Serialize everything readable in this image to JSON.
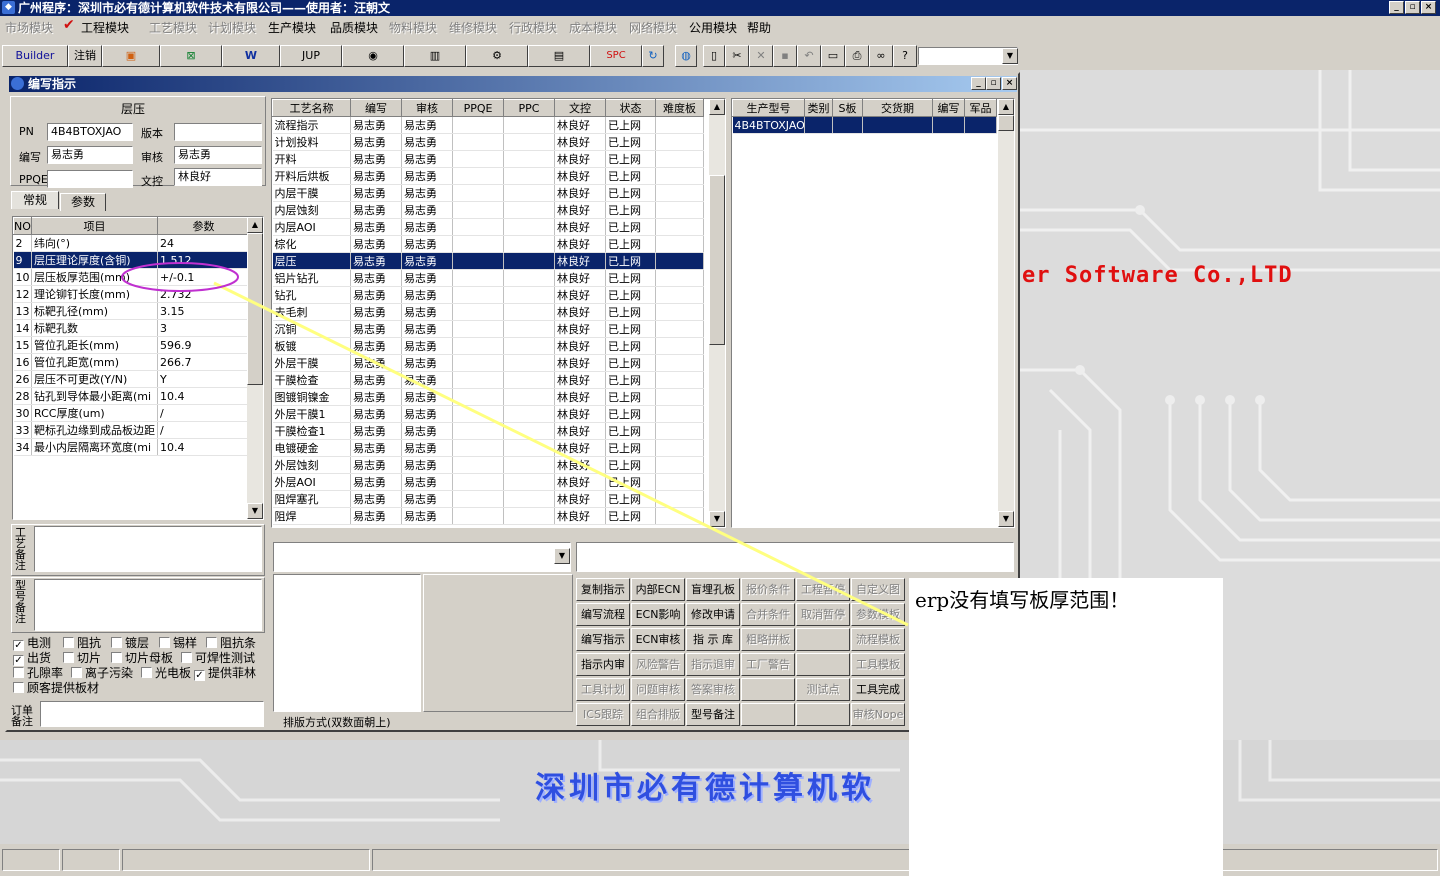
{
  "window": {
    "title": "广州程序：深圳市必有德计算机软件技术有限公司——使用者：汪朝文",
    "buttons": [
      "_",
      "▫",
      "×"
    ]
  },
  "menu": [
    {
      "label": "市场模块",
      "enabled": false
    },
    {
      "label": "工程模块",
      "enabled": true,
      "checked": true
    },
    {
      "label": "工艺模块",
      "enabled": false
    },
    {
      "label": "计划模块",
      "enabled": false
    },
    {
      "label": "生产模块",
      "enabled": true
    },
    {
      "label": "品质模块",
      "enabled": true
    },
    {
      "label": "物料模块",
      "enabled": false
    },
    {
      "label": "维修模块",
      "enabled": false
    },
    {
      "label": "行政模块",
      "enabled": false
    },
    {
      "label": "成本模块",
      "enabled": false
    },
    {
      "label": "网络模块",
      "enabled": false
    },
    {
      "label": "公用模块",
      "enabled": true
    },
    {
      "label": "帮助",
      "enabled": true
    }
  ],
  "toolbar": {
    "builder": "Builder",
    "logout": "注销",
    "jup": "JUP",
    "spc": "SPC",
    "combo_value": ""
  },
  "child": {
    "title": "编写指示",
    "section_title": "层压",
    "fields": {
      "pn_label": "PN",
      "pn_value": "4B4BTOXJAO",
      "version_label": "版本",
      "version_value": "",
      "author_label": "编写",
      "author_value": "易志勇",
      "review_label": "审核",
      "review_value": "易志勇",
      "ppqe_label": "PPQE",
      "ppqe_value": "",
      "doc_label": "文控",
      "doc_value": "林良好"
    },
    "tabs": [
      "常规",
      "参数"
    ],
    "param_headers": [
      "NO",
      "项目",
      "参数"
    ],
    "params": [
      [
        "2",
        "纬向(°)",
        "24"
      ],
      [
        "9",
        "层压理论厚度(含铜)",
        "1.512"
      ],
      [
        "10",
        "层压板厚范围(mm)",
        "+/-0.1"
      ],
      [
        "12",
        "理论铆钉长度(mm)",
        "2.732"
      ],
      [
        "13",
        "标靶孔径(mm)",
        "3.15"
      ],
      [
        "14",
        "标靶孔数",
        "3"
      ],
      [
        "15",
        "管位孔距长(mm)",
        "596.9"
      ],
      [
        "16",
        "管位孔距宽(mm)",
        "266.7"
      ],
      [
        "26",
        "层压不可更改(Y/N)",
        "Y"
      ],
      [
        "28",
        "钻孔到导体最小距离(mi",
        "10.4"
      ],
      [
        "30",
        "RCC厚度(um)",
        "/"
      ],
      [
        "33",
        "靶标孔边缘到成品板边距",
        "/"
      ],
      [
        "34",
        "最小内层隔离环宽度(mi",
        "10.4"
      ]
    ],
    "process_note_label": "工艺备注",
    "model_note_label": "型号备注",
    "order_note_label": "订单备注",
    "checkboxes": [
      {
        "label": "电测",
        "checked": true
      },
      {
        "label": "阻抗",
        "checked": false
      },
      {
        "label": "镀层",
        "checked": false
      },
      {
        "label": "锡样",
        "checked": false
      },
      {
        "label": "阻抗条",
        "checked": false
      },
      {
        "label": "出货",
        "checked": true
      },
      {
        "label": "切片",
        "checked": false
      },
      {
        "label": "切片母板",
        "checked": false
      },
      {
        "label": "可焊性测试",
        "checked": false
      },
      {
        "label": "孔隙率",
        "checked": false
      },
      {
        "label": "离子污染",
        "checked": false
      },
      {
        "label": "光电板",
        "checked": false
      },
      {
        "label": "提供菲林",
        "checked": true
      },
      {
        "label": "顾客提供板材",
        "checked": false
      }
    ],
    "process_headers": [
      "工艺名称",
      "编写",
      "审核",
      "PPQE",
      "PPC",
      "文控",
      "状态",
      "难度板"
    ],
    "processes": [
      [
        "流程指示",
        "易志勇",
        "易志勇",
        "",
        "",
        "林良好",
        "已上网",
        ""
      ],
      [
        "计划投料",
        "易志勇",
        "易志勇",
        "",
        "",
        "林良好",
        "已上网",
        ""
      ],
      [
        "开料",
        "易志勇",
        "易志勇",
        "",
        "",
        "林良好",
        "已上网",
        ""
      ],
      [
        "开料后烘板",
        "易志勇",
        "易志勇",
        "",
        "",
        "林良好",
        "已上网",
        ""
      ],
      [
        "内层干膜",
        "易志勇",
        "易志勇",
        "",
        "",
        "林良好",
        "已上网",
        ""
      ],
      [
        "内层蚀刻",
        "易志勇",
        "易志勇",
        "",
        "",
        "林良好",
        "已上网",
        ""
      ],
      [
        "内层AOI",
        "易志勇",
        "易志勇",
        "",
        "",
        "林良好",
        "已上网",
        ""
      ],
      [
        "棕化",
        "易志勇",
        "易志勇",
        "",
        "",
        "林良好",
        "已上网",
        ""
      ],
      [
        "层压",
        "易志勇",
        "易志勇",
        "",
        "",
        "林良好",
        "已上网",
        ""
      ],
      [
        "铝片钻孔",
        "易志勇",
        "易志勇",
        "",
        "",
        "林良好",
        "已上网",
        ""
      ],
      [
        "钻孔",
        "易志勇",
        "易志勇",
        "",
        "",
        "林良好",
        "已上网",
        ""
      ],
      [
        "去毛刺",
        "易志勇",
        "易志勇",
        "",
        "",
        "林良好",
        "已上网",
        ""
      ],
      [
        "沉铜",
        "易志勇",
        "易志勇",
        "",
        "",
        "林良好",
        "已上网",
        ""
      ],
      [
        "板镀",
        "易志勇",
        "易志勇",
        "",
        "",
        "林良好",
        "已上网",
        ""
      ],
      [
        "外层干膜",
        "易志勇",
        "易志勇",
        "",
        "",
        "林良好",
        "已上网",
        ""
      ],
      [
        "干膜检查",
        "易志勇",
        "易志勇",
        "",
        "",
        "林良好",
        "已上网",
        ""
      ],
      [
        "图镀铜镍金",
        "易志勇",
        "易志勇",
        "",
        "",
        "林良好",
        "已上网",
        ""
      ],
      [
        "外层干膜1",
        "易志勇",
        "易志勇",
        "",
        "",
        "林良好",
        "已上网",
        ""
      ],
      [
        "干膜检查1",
        "易志勇",
        "易志勇",
        "",
        "",
        "林良好",
        "已上网",
        ""
      ],
      [
        "电镀硬金",
        "易志勇",
        "易志勇",
        "",
        "",
        "林良好",
        "已上网",
        ""
      ],
      [
        "外层蚀刻",
        "易志勇",
        "易志勇",
        "",
        "",
        "林良好",
        "已上网",
        ""
      ],
      [
        "外层AOI",
        "易志勇",
        "易志勇",
        "",
        "",
        "林良好",
        "已上网",
        ""
      ],
      [
        "阻焊塞孔",
        "易志勇",
        "易志勇",
        "",
        "",
        "林良好",
        "已上网",
        ""
      ],
      [
        "阻焊",
        "易志勇",
        "易志勇",
        "",
        "",
        "林良好",
        "已上网",
        ""
      ]
    ],
    "selected_process_index": 8,
    "model_headers": [
      "生产型号",
      "类别",
      "S板",
      "交货期",
      "编写",
      "军品"
    ],
    "models": [
      [
        "4B4BTOXJAO",
        "",
        "",
        "",
        "",
        ""
      ]
    ],
    "layout_label": "排版方式(双数面朝上)",
    "action_buttons": [
      [
        {
          "label": "复制指示",
          "enabled": true
        },
        {
          "label": "内部ECN",
          "enabled": true
        },
        {
          "label": "盲埋孔板",
          "enabled": true
        },
        {
          "label": "报价条件",
          "enabled": false
        },
        {
          "label": "工程暂停",
          "enabled": false
        },
        {
          "label": "自定义图",
          "enabled": false
        }
      ],
      [
        {
          "label": "编写流程",
          "enabled": true
        },
        {
          "label": "ECN影响",
          "enabled": true
        },
        {
          "label": "修改申请",
          "enabled": true
        },
        {
          "label": "合并条件",
          "enabled": false
        },
        {
          "label": "取消暂停",
          "enabled": false
        },
        {
          "label": "参数模板",
          "enabled": false
        }
      ],
      [
        {
          "label": "编写指示",
          "enabled": true
        },
        {
          "label": "ECN审核",
          "enabled": true
        },
        {
          "label": "指 示 库",
          "enabled": true
        },
        {
          "label": "粗略拼板",
          "enabled": false
        },
        {
          "label": "",
          "enabled": false
        },
        {
          "label": "流程模板",
          "enabled": false
        }
      ],
      [
        {
          "label": "指示内审",
          "enabled": true
        },
        {
          "label": "风险警告",
          "enabled": false
        },
        {
          "label": "指示退审",
          "enabled": false
        },
        {
          "label": "工厂警告",
          "enabled": false
        },
        {
          "label": "",
          "enabled": false
        },
        {
          "label": "工具模板",
          "enabled": false
        }
      ],
      [
        {
          "label": "工具计划",
          "enabled": false
        },
        {
          "label": "问题审核",
          "enabled": false
        },
        {
          "label": "答案审核",
          "enabled": false
        },
        {
          "label": "",
          "enabled": false
        },
        {
          "label": "测试点",
          "enabled": false
        },
        {
          "label": "工具完成",
          "enabled": true
        }
      ],
      [
        {
          "label": "ICS跟踪",
          "enabled": false
        },
        {
          "label": "组合排版",
          "enabled": false
        },
        {
          "label": "型号备注",
          "enabled": true
        },
        {
          "label": "",
          "enabled": false
        },
        {
          "label": "",
          "enabled": false
        },
        {
          "label": "审核Nope",
          "enabled": false
        }
      ]
    ]
  },
  "watermark_right": "er Software Co.,LTD",
  "watermark_bottom": "深圳市必有德计算机软",
  "note": "erp没有填写板厚范围！",
  "colors": {
    "titlebar": "#0a246a",
    "selection": "#0a246a",
    "annotation_ellipse": "#c030d0",
    "annotation_line": "#ffff80",
    "watermark_red": "#e01010",
    "watermark_blue": "#2f4fe0"
  }
}
